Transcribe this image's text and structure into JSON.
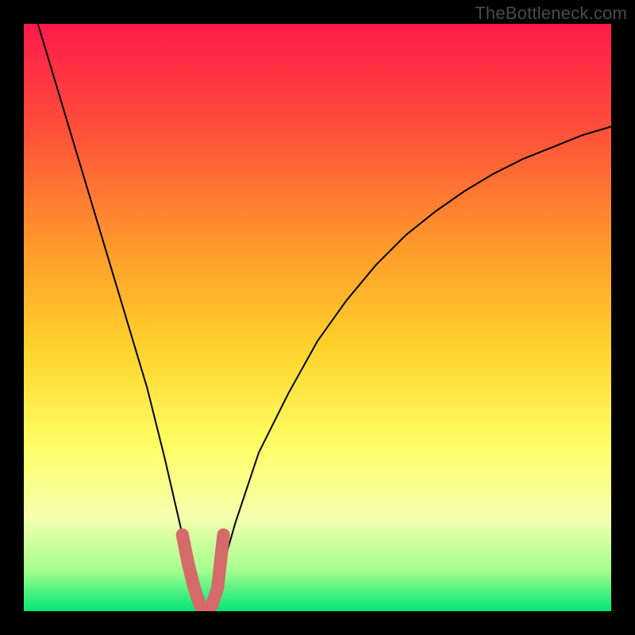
{
  "watermark": "TheBottleneck.com",
  "colors": {
    "background": "#000000",
    "gradient_top": "#ff1a4b",
    "gradient_mid1": "#ff7a2b",
    "gradient_mid2": "#ffd22b",
    "gradient_mid3": "#ffff66",
    "gradient_mid4": "#f6ffb0",
    "gradient_bottom1": "#a5ff8d",
    "gradient_bottom2": "#00e676",
    "curve": "#000000",
    "badge_stroke": "#d46a6a",
    "watermark": "#4a4a4a"
  },
  "chart_data": {
    "type": "line",
    "title": "",
    "xlabel": "",
    "ylabel": "",
    "xlim": [
      0,
      100
    ],
    "ylim": [
      0,
      100
    ],
    "series": [
      {
        "name": "bottleneck-curve",
        "x": [
          0,
          3,
          6,
          9,
          12,
          15,
          18,
          21,
          24,
          27,
          28,
          29,
          30,
          31,
          32,
          33,
          34,
          36,
          40,
          45,
          50,
          55,
          60,
          65,
          70,
          75,
          80,
          85,
          90,
          95,
          100
        ],
        "values": [
          108,
          98,
          88,
          78,
          68,
          58,
          48,
          38,
          26,
          13,
          8,
          4,
          1,
          0,
          1,
          4,
          8,
          15,
          27,
          37,
          46,
          53,
          59,
          64,
          68,
          71.5,
          74.5,
          77,
          79,
          81,
          82.5
        ]
      }
    ],
    "badge": {
      "description": "rounded U-shaped marker at curve minimum",
      "x_range": [
        26.5,
        35.5
      ],
      "y_range": [
        0,
        13
      ],
      "stroke_width_pct": 2.2
    },
    "gradient_stops": [
      {
        "offset": 0.0,
        "color": "#ff1a4b"
      },
      {
        "offset": 0.18,
        "color": "#ff4f3a"
      },
      {
        "offset": 0.38,
        "color": "#ff9a2b"
      },
      {
        "offset": 0.55,
        "color": "#ffd22b"
      },
      {
        "offset": 0.72,
        "color": "#ffff66"
      },
      {
        "offset": 0.84,
        "color": "#f6ffb0"
      },
      {
        "offset": 0.93,
        "color": "#a5ff8d"
      },
      {
        "offset": 1.0,
        "color": "#00e676"
      }
    ]
  }
}
